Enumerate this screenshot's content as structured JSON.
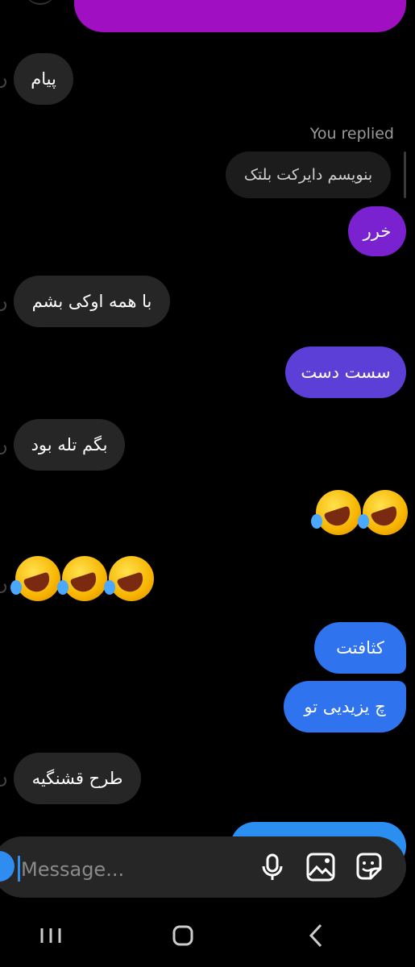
{
  "messages": {
    "received_1": "پیام",
    "reply_label": "You replied",
    "reply_quote": "بنویسم دایرکت بلتک",
    "sent_1": "خرر",
    "received_2": "با همه اوکی بشم",
    "sent_2": "سست دست",
    "received_3": "بگم تله بود",
    "sent_3": "کثافتت",
    "sent_4": "چ یزیدیی تو",
    "received_4": "طرح قشنگیه"
  },
  "composer": {
    "placeholder": "Message..."
  },
  "colors": {
    "top_bubble": "#a10fc2",
    "sent_1": "#7a22cf",
    "sent_2": "#5b3fd6",
    "sent_blue": "#2f74ee",
    "bottom_bubble": "#2a8ff0",
    "received": "#262626"
  },
  "icons": [
    "microphone-icon",
    "gallery-icon",
    "sticker-icon",
    "recent-apps-icon",
    "home-icon",
    "back-icon"
  ]
}
